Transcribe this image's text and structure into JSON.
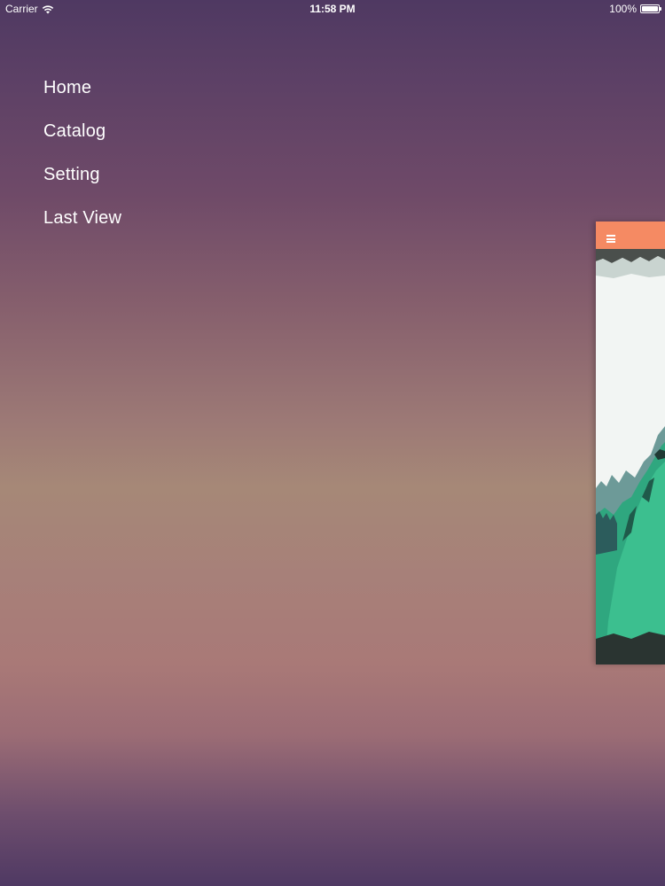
{
  "status_bar": {
    "carrier": "Carrier",
    "time": "11:58 PM",
    "battery": "100%"
  },
  "menu": {
    "items": [
      {
        "label": "Home"
      },
      {
        "label": "Catalog"
      },
      {
        "label": "Setting"
      },
      {
        "label": "Last View"
      }
    ]
  },
  "content_preview": {
    "nav_color": "#f58a63",
    "menu_icon": "hamburger-icon",
    "artwork": "mountain-landscape-painting"
  },
  "colors": {
    "background_top": "#4f3962",
    "background_mid": "#a68877",
    "accent": "#f58a63"
  }
}
